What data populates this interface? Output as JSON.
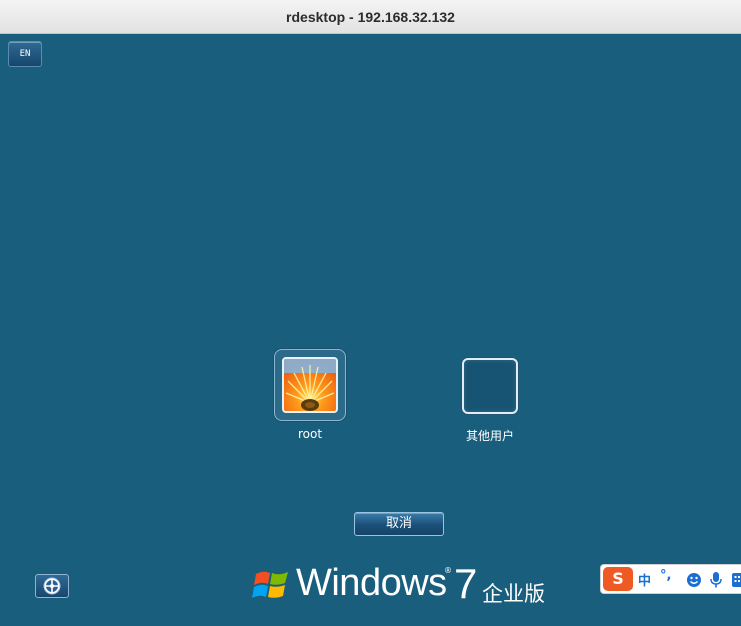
{
  "window": {
    "title": "rdesktop - 192.168.32.132"
  },
  "toolbar": {
    "language": "EN"
  },
  "users": [
    {
      "name": "root",
      "avatar": "flower-avatar"
    },
    {
      "name": "其他用户",
      "avatar": "blank-avatar"
    }
  ],
  "actions": {
    "cancel_label": "取消"
  },
  "branding": {
    "windows_word": "Windows",
    "version": "7",
    "edition": "企业版"
  },
  "ime_bar": {
    "logo": "S",
    "mode": "中",
    "punctuation": "°,",
    "icons": [
      "smiley-icon",
      "microphone-icon",
      "keyboard-icon"
    ]
  },
  "colors": {
    "background": "#1a5e7e",
    "ime_logo": "#ef5a24",
    "ime_text": "#1b6fd0"
  }
}
